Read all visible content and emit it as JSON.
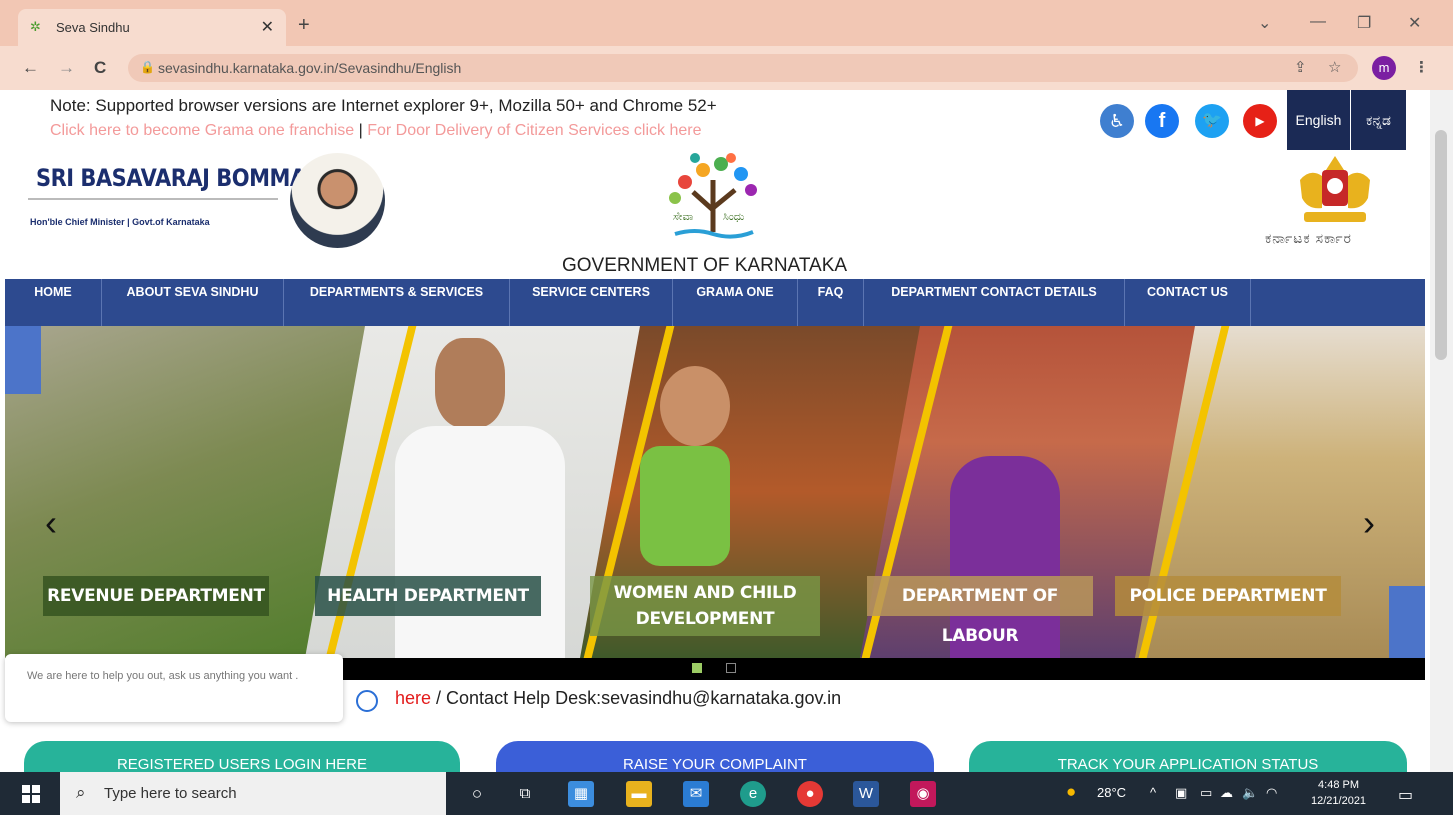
{
  "browser": {
    "tab_title": "Seva Sindhu",
    "tab_close": "✕",
    "new_tab": "+",
    "url": "sevasindhu.karnataka.gov.in/Sevasindhu/English",
    "profile_initial": "m",
    "back": "←",
    "forward": "→",
    "reload": "C"
  },
  "header": {
    "note": "Note: Supported browser versions are Internet explorer 9+, Mozilla 50+ and Chrome 52+",
    "franchise_link": "Click here to become Grama one franchise",
    "separator": " | ",
    "door_delivery_link": "For Door Delivery of Citizen Services click here",
    "lang_english": "English",
    "lang_kannada": "ಕನ್ನಡ",
    "cm_name": "SRI BASAVARAJ BOMMAI",
    "cm_title": "Hon'ble Chief Minister | Govt.of Karnataka",
    "gov_title": "GOVERNMENT OF KARNATAKA",
    "emblem_caption": "ಕರ್ನಾಟಕ ಸರ್ಕಾರ",
    "accent_color": "#2d4a8f"
  },
  "nav": {
    "items": [
      "HOME",
      "ABOUT SEVA SINDHU",
      "DEPARTMENTS & SERVICES",
      "SERVICE CENTERS",
      "GRAMA ONE",
      "FAQ",
      "DEPARTMENT CONTACT DETAILS",
      "CONTACT US"
    ]
  },
  "slider": {
    "labels": [
      "REVENUE DEPARTMENT",
      "HEALTH DEPARTMENT",
      "WOMEN AND CHILD DEVELOPMENT",
      "DEPARTMENT OF LABOUR",
      "POLICE DEPARTMENT"
    ],
    "prev": "‹",
    "next": "›"
  },
  "chat": {
    "message": "We are here to help you out, ask us anything you want ."
  },
  "help": {
    "here_text": "here",
    "contact_text": " / Contact Help Desk:sevasindhu@karnataka.gov.in"
  },
  "actions": {
    "login": "REGISTERED USERS LOGIN HERE",
    "complaint": "RAISE YOUR COMPLAINT",
    "track": "TRACK YOUR APPLICATION STATUS"
  },
  "taskbar": {
    "search_placeholder": "Type here to search",
    "temperature": "28°C",
    "time": "4:48 PM",
    "date": "12/21/2021"
  }
}
